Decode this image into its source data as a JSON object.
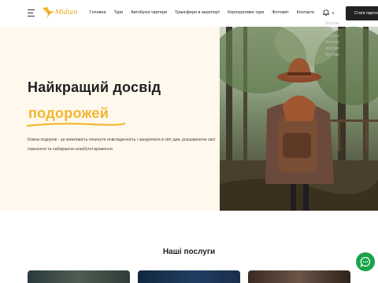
{
  "header": {
    "logo_text": "Midian",
    "nav": [
      "Головна",
      "Тури",
      "Автобусні чартери",
      "Трансфери в аеропорт",
      "Корпоративні тури",
      "Фотозвіт",
      "Контакти"
    ],
    "cta_label": "Стати партнером"
  },
  "hero": {
    "title": "Найкращий досвід",
    "accent": "подорожей",
    "description": "Кожна подорож - це можливість покинути повсякденність і зануритися в світ див, розширюючи свої горизонти та набираючи незабутні враження."
  },
  "ghost_menu": [
    "Хостинг",
    "Хостинг",
    "Хостинг",
    "Хостинг",
    "Хостинг",
    "Хостинг"
  ],
  "services": {
    "title": "Наші послуги"
  },
  "colors": {
    "accent": "#f2b632",
    "hero_bg": "#fff8ec",
    "chat": "#1aa34a",
    "dark": "#222222"
  },
  "icons": [
    "menu-icon",
    "logo-bird-icon",
    "bell-icon",
    "chevron-down-icon",
    "chat-icon"
  ]
}
